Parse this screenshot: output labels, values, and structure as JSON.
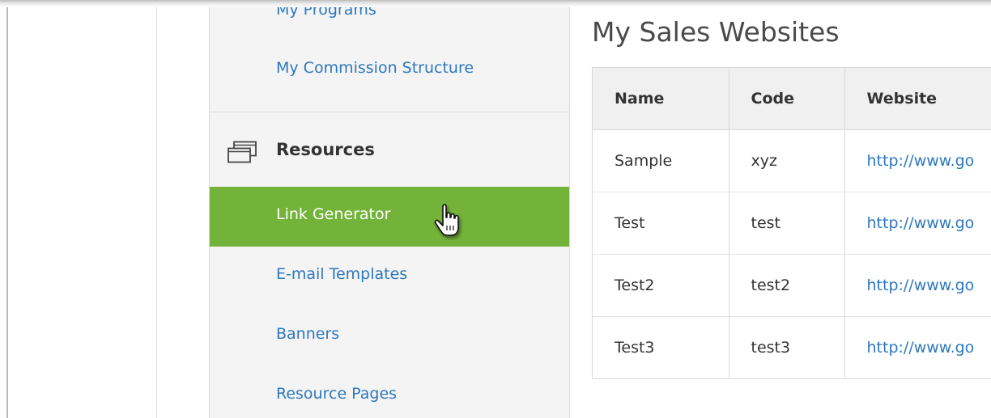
{
  "sidebar": {
    "cut_link": "My Programs",
    "commission_link": "My Commission Structure",
    "section": {
      "icon": "windows-icon",
      "title": "Resources"
    },
    "items": [
      {
        "label": "Link Generator",
        "active": true
      },
      {
        "label": "E-mail Templates",
        "active": false
      },
      {
        "label": "Banners",
        "active": false
      },
      {
        "label": "Resource Pages",
        "active": false
      }
    ]
  },
  "main": {
    "title": "My Sales Websites",
    "table": {
      "columns": [
        "Name",
        "Code",
        "Website"
      ],
      "rows": [
        {
          "name": "Sample",
          "code": "xyz",
          "website": "http://www.go"
        },
        {
          "name": "Test",
          "code": "test",
          "website": "http://www.go"
        },
        {
          "name": "Test2",
          "code": "test2",
          "website": "http://www.go"
        },
        {
          "name": "Test3",
          "code": "test3",
          "website": "http://www.go"
        }
      ]
    }
  },
  "colors": {
    "accent": "#74b33a",
    "link": "#2d78bd",
    "sidebar_bg": "#f4f4f4"
  },
  "icons": {
    "section": "windows-icon",
    "pointer": "hand-pointer-icon"
  }
}
